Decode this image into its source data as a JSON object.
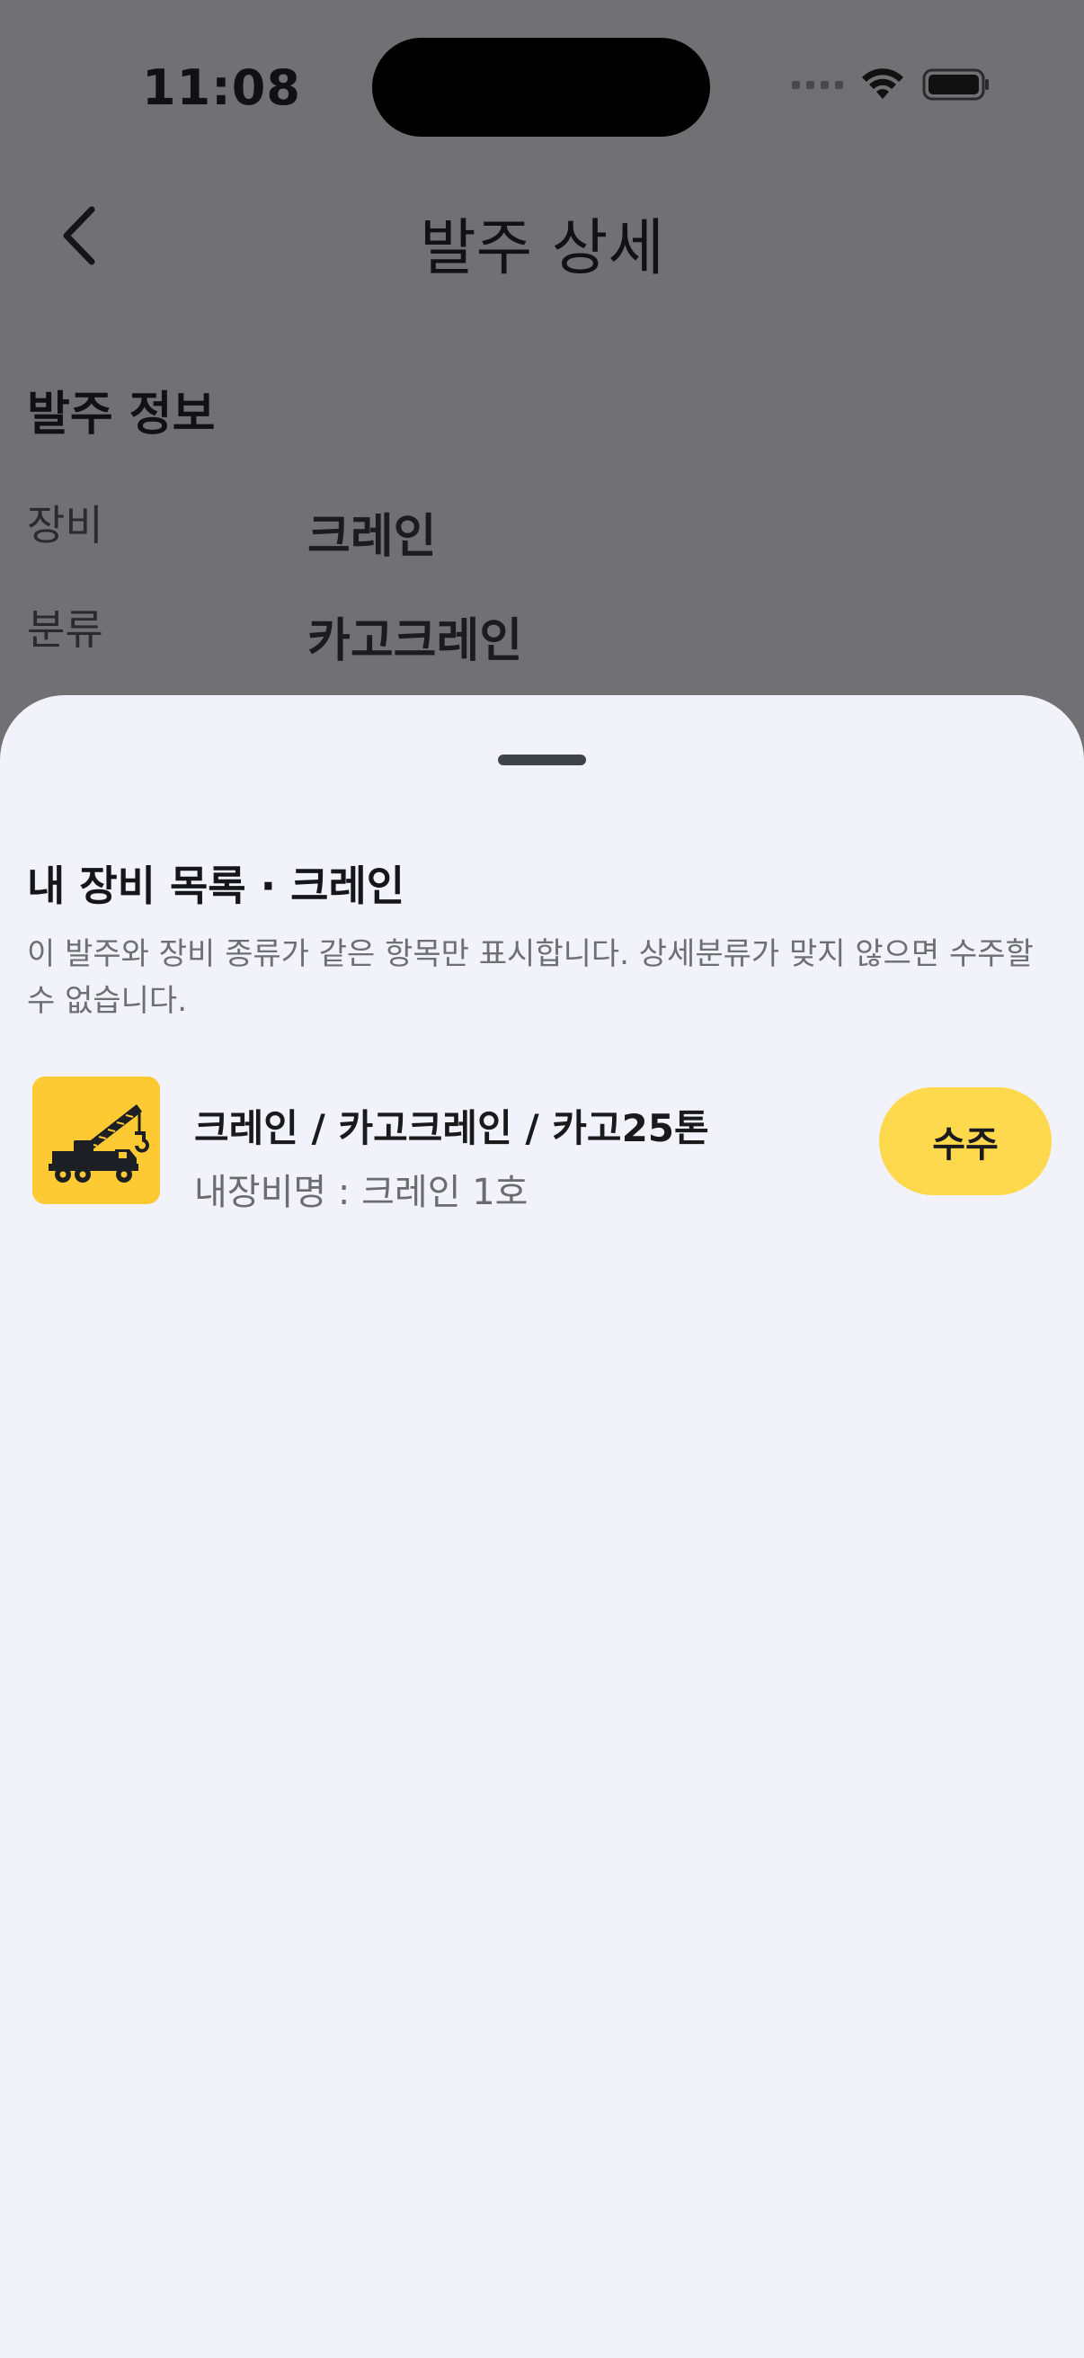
{
  "status_bar": {
    "time": "11:08"
  },
  "header": {
    "title": "발주 상세"
  },
  "order_info": {
    "section_title": "발주 정보",
    "rows": [
      {
        "label": "장비",
        "value": "크레인"
      },
      {
        "label": "분류",
        "value": "카고크레인"
      }
    ]
  },
  "sheet": {
    "title": "내 장비 목록 · 크레인",
    "description": "이 발주와 장비 종류가 같은 항목만 표시합니다. 상세분류가 맞지 않으면 수주할 수 없습니다.",
    "items": [
      {
        "icon": "crane-truck-icon",
        "name": "크레인 / 카고크레인 / 카고25톤",
        "subtitle": "내장비명 : 크레인 1호",
        "action_label": "수주"
      }
    ]
  },
  "colors": {
    "dimmed_background": "#717173",
    "sheet_background": "#f1f2fa",
    "accent_yellow": "#fed94d",
    "icon_yellow": "#fdca34"
  }
}
